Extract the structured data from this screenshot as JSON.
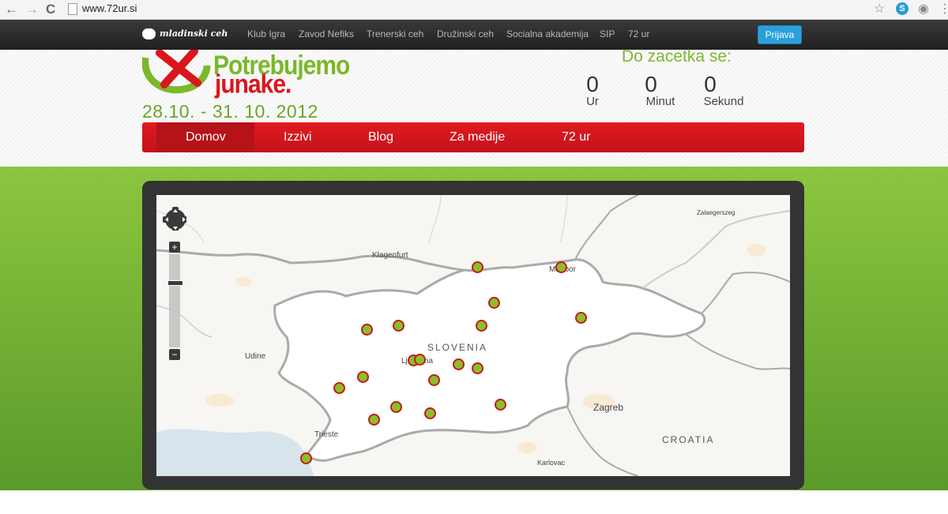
{
  "browser": {
    "url": "www.72ur.si",
    "back_icon": "←",
    "forward_icon": "→",
    "reload_icon": "C",
    "star_icon": "☆",
    "skype_icon": "S",
    "eye_icon": "◉",
    "menu_icon": "⋮"
  },
  "topbar": {
    "brand": "mladinski ceh",
    "links": [
      "Klub Igra",
      "Zavod Nefiks",
      "Trenerski ceh",
      "Družinski ceh",
      "Socialna akademija",
      "SIP",
      "72 ur"
    ],
    "login_label": "Prijava"
  },
  "header": {
    "logo_line1": "Potrebujemo",
    "logo_line2": "junake.",
    "dates": "28.10. - 31. 10. 2012",
    "countdown_title": "Do zacetka se:",
    "countdown": {
      "hours_value": "0",
      "hours_label": "Ur",
      "minutes_value": "0",
      "minutes_label": "Minut",
      "seconds_value": "0",
      "seconds_label": "Sekund"
    }
  },
  "nav": {
    "items": [
      "Domov",
      "Izzivi",
      "Blog",
      "Za medije",
      "72 ur"
    ],
    "active": "Domov"
  },
  "map": {
    "countries": [
      "SLOVENIA",
      "CROATIA"
    ],
    "cities": [
      "Klagenfurt",
      "Maribor",
      "Zalaegerszeg",
      "Udine",
      "Ljubljana",
      "Zagreb",
      "Trieste",
      "Karlovac"
    ],
    "zoom_in_label": "+",
    "zoom_out_label": "−",
    "marker_count": 20,
    "colors": {
      "marker_fill": "#8bbf2a",
      "marker_border": "#c41a1a"
    }
  }
}
